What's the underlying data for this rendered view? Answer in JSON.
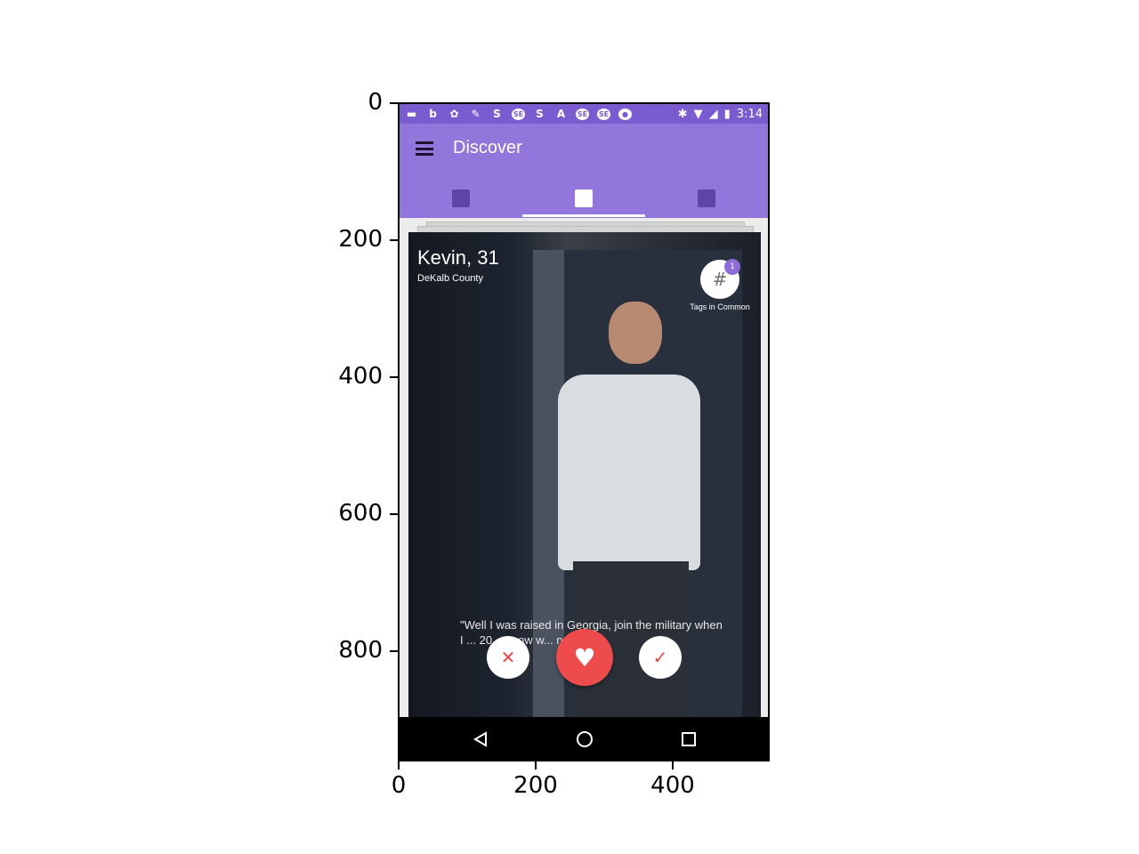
{
  "axes": {
    "y_ticks": [
      "0",
      "200",
      "400",
      "600",
      "800"
    ],
    "x_ticks": [
      "0",
      "200",
      "400"
    ]
  },
  "status_bar": {
    "time": "3:14",
    "left_icons": [
      "chat-icon",
      "b-icon",
      "puzzle-icon",
      "wrench-icon",
      "s-icon",
      "badge-icon",
      "s-icon",
      "a-icon",
      "badge-icon",
      "badge-icon",
      "badge-icon"
    ],
    "right_icons": [
      "bluetooth-icon",
      "wifi-icon",
      "signal-icon",
      "battery-icon"
    ]
  },
  "app_bar": {
    "title": "Discover",
    "tabs": [
      "profile-tab",
      "discover-tab",
      "messages-tab"
    ],
    "active_tab": 1
  },
  "profile": {
    "name": "Kevin, 31",
    "location": "DeKalb County",
    "tags_badge": "1",
    "tags_label": "Tags in Common",
    "quote": "\"Well I was raised in Georgia, join the military when I ... 20, ... now w... ng as a..."
  },
  "actions": {
    "pass_glyph": "✕",
    "like_glyph": "♥",
    "accept_glyph": "✓"
  },
  "colors": {
    "status_bar": "#7b5cd0",
    "app_bar": "#9376db",
    "like": "#ee4c4c",
    "badge": "#8e6bd8"
  }
}
